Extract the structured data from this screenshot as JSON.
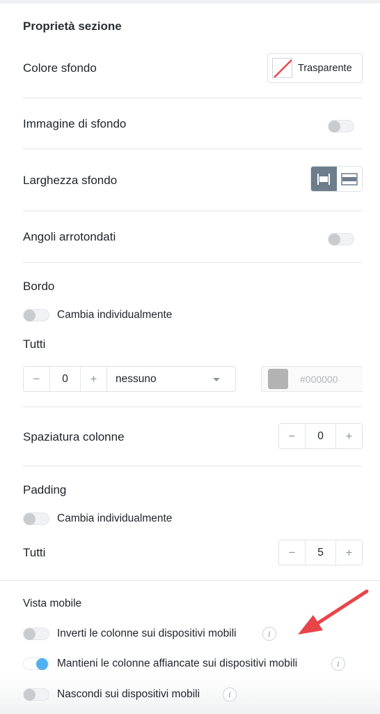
{
  "section_title": "Proprietà sezione",
  "background_color": {
    "label": "Colore sfondo",
    "value_label": "Trasparente"
  },
  "background_image": {
    "label": "Immagine di sfondo",
    "enabled": false
  },
  "background_width": {
    "label": "Larghezza sfondo",
    "options": [
      "contained-icon",
      "full-width-icon"
    ],
    "selected": "contained-icon"
  },
  "rounded_corners": {
    "label": "Angoli arrotondati",
    "enabled": false
  },
  "border": {
    "label": "Bordo",
    "individually_label": "Cambia individualmente",
    "all_label": "Tutti",
    "minus": "−",
    "plus": "+",
    "width_value": "0",
    "style_value": "nessuno",
    "color_hex_placeholder": "#000000",
    "color_swatch": "#b3b3b3"
  },
  "column_spacing": {
    "label": "Spaziatura colonne",
    "minus": "−",
    "plus": "+",
    "value": "0"
  },
  "padding": {
    "label": "Padding",
    "individually_label": "Cambia individualmente",
    "all_label": "Tutti",
    "minus": "−",
    "plus": "+",
    "value": "5"
  },
  "mobile_view": {
    "label": "Vista mobile",
    "options": [
      {
        "label": "Inverti le colonne sui dispositivi mobili",
        "enabled": false,
        "info": "i"
      },
      {
        "label": "Mantieni le colonne affiancate sui dispositivi mobili",
        "enabled": true,
        "info": "i"
      },
      {
        "label": "Nascondi sui dispositivi mobili",
        "enabled": false,
        "info": "i"
      }
    ]
  },
  "colors": {
    "accent": "#4fb1f2",
    "arrow": "#e8454a",
    "segment_active": "#6d7d8b"
  }
}
